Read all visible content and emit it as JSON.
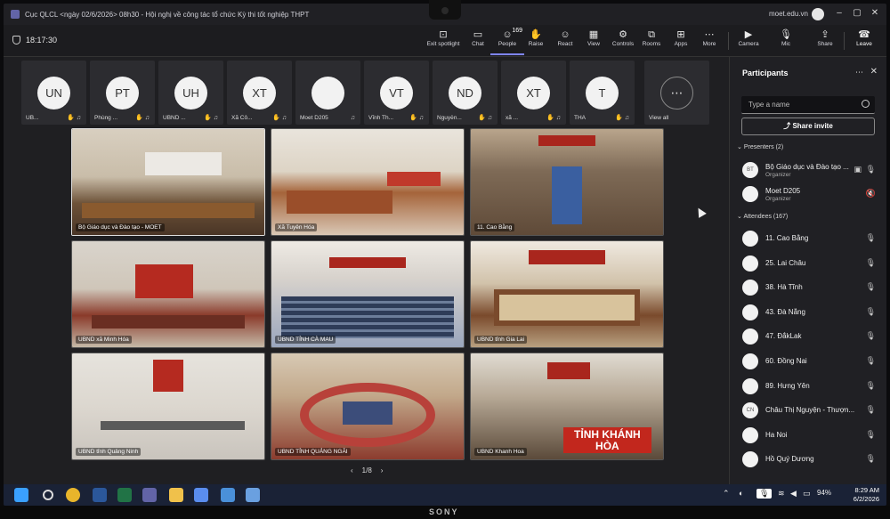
{
  "window": {
    "title": "Cục QLCL <ngày 02/6/2026> 08h30 - Hội nghị về công tác tổ chức Kỳ thi tốt nghiệp THPT",
    "account": "moet.edu.vn"
  },
  "toolbar": {
    "timer": "18:17:30",
    "exit_spotlight": "Exit spotlight",
    "chat": "Chat",
    "people": "People",
    "people_count": "169",
    "raise": "Raise",
    "react": "React",
    "view": "View",
    "controls": "Controls",
    "rooms": "Rooms",
    "apps": "Apps",
    "more": "More",
    "camera": "Camera",
    "mic": "Mic",
    "share": "Share",
    "leave": "Leave"
  },
  "strip": {
    "tiles": [
      {
        "initials": "UN",
        "name": "UB..."
      },
      {
        "initials": "PT",
        "name": "Phùng ..."
      },
      {
        "initials": "UH",
        "name": "UBND ..."
      },
      {
        "initials": "XT",
        "name": "Xã Cô..."
      },
      {
        "initials": "",
        "name": "Moet D205"
      },
      {
        "initials": "VT",
        "name": "Vĩnh Th..."
      },
      {
        "initials": "ND",
        "name": "Nguyễn..."
      },
      {
        "initials": "XT",
        "name": "xã ..."
      },
      {
        "initials": "T",
        "name": "THA"
      }
    ],
    "view_all": "View all"
  },
  "grid": {
    "tiles": [
      {
        "label": "Bộ Giáo dục và Đào tạo - MOET"
      },
      {
        "label": "Xã Tuyên Hóa"
      },
      {
        "label": "11. Cao Bằng"
      },
      {
        "label": "UBND xã Minh Hóa"
      },
      {
        "label": "UBND TỈNH CÀ MAU"
      },
      {
        "label": "UBND tỉnh Gia Lai"
      },
      {
        "label": "UBND tỉnh Quảng Ninh"
      },
      {
        "label": "UBND TỈNH QUẢNG NGÃI"
      },
      {
        "label": "UBND Khanh Hoa"
      }
    ],
    "tinh_sign": "TỈNH KHÁNH HÒA",
    "pager": "1/8"
  },
  "panel": {
    "title": "Participants",
    "search_placeholder": "Type a name",
    "share_invite": "Share invite",
    "presenters_label": "Presenters (2)",
    "presenters": [
      {
        "initials": "BT",
        "name": "Bộ Giáo dục và Đào tạo ...",
        "role": "Organizer"
      },
      {
        "initials": "",
        "name": "Moet D205",
        "role": "Organizer"
      }
    ],
    "attendees_label": "Attendees (167)",
    "attendees": [
      {
        "initials": "",
        "name": "11. Cao Bằng"
      },
      {
        "initials": "",
        "name": "25. Lai Châu"
      },
      {
        "initials": "",
        "name": "38. Hà Tĩnh"
      },
      {
        "initials": "",
        "name": "43. Đà Nẵng"
      },
      {
        "initials": "",
        "name": "47. ĐắkLak"
      },
      {
        "initials": "",
        "name": "60. Đồng Nai"
      },
      {
        "initials": "",
        "name": "89. Hưng Yên"
      },
      {
        "initials": "CN",
        "name": "Châu Thị Nguyện - Thượn..."
      },
      {
        "initials": "",
        "name": "Ha Noi"
      },
      {
        "initials": "",
        "name": "Hồ Quý Dương"
      }
    ]
  },
  "taskbar": {
    "battery": "94%",
    "time": "8:29 AM",
    "date": "6/2/2026"
  },
  "bezel": {
    "brand": "SONY"
  }
}
